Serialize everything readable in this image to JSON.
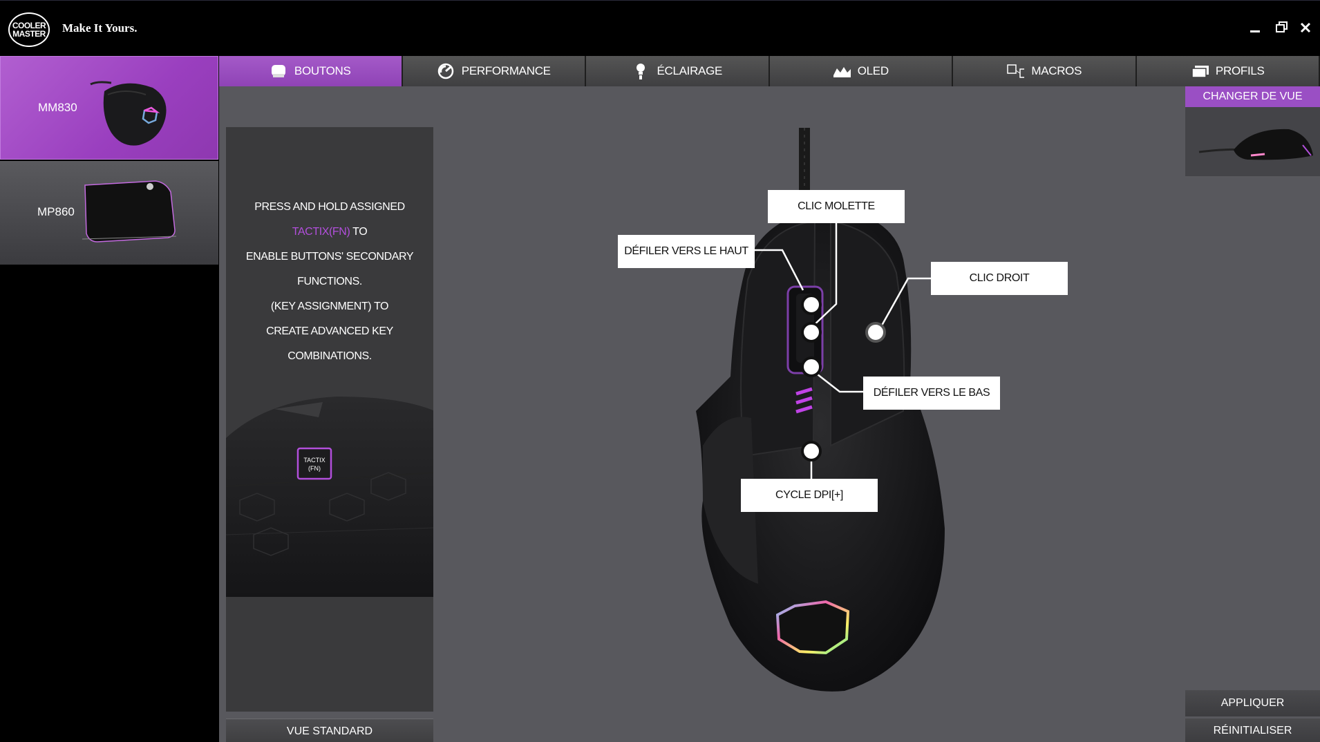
{
  "titlebar": {
    "logo_line1": "COOLER",
    "logo_line2": "MASTER",
    "tagline": "Make It Yours.",
    "minimize_icon": "minimize-icon",
    "restore_icon": "restore-icon",
    "close_icon": "close-icon"
  },
  "sidebar": {
    "devices": [
      {
        "label": "MM830",
        "icon": "mouse-icon",
        "selected": true
      },
      {
        "label": "MP860",
        "icon": "mousepad-icon",
        "selected": false
      }
    ]
  },
  "tabs": [
    {
      "label": "BOUTONS",
      "icon": "mouse-icon",
      "active": true
    },
    {
      "label": "PERFORMANCE",
      "icon": "gauge-icon",
      "active": false
    },
    {
      "label": "ÉCLAIRAGE",
      "icon": "bulb-icon",
      "active": false
    },
    {
      "label": "OLED",
      "icon": "oled-display-icon",
      "active": false
    },
    {
      "label": "MACROS",
      "icon": "macro-keys-icon",
      "active": false
    },
    {
      "label": "PROFILS",
      "icon": "profiles-icon",
      "active": false
    }
  ],
  "info": {
    "line1_pre": "PRESS AND HOLD ASSIGNED ",
    "line1_hl": "TACTIX(FN)",
    "line1_post": " TO",
    "line2": "ENABLE BUTTONS' SECONDARY FUNCTIONS.",
    "line3": "(KEY ASSIGNMENT) TO",
    "line4": "CREATE ADVANCED KEY COMBINATIONS.",
    "tactix_key_line1": "TACTIX",
    "tactix_key_line2": "(FN)",
    "standard_view_button": "VUE STANDARD"
  },
  "callouts": {
    "wheel_click": "CLIC MOLETTE",
    "scroll_up": "DÉFILER VERS LE HAUT",
    "right_click": "CLIC DROIT",
    "scroll_down": "DÉFILER VERS LE BAS",
    "dpi_cycle": "CYCLE DPI[+]"
  },
  "right_panel": {
    "change_view_button": "CHANGER DE VUE",
    "apply_button": "APPLIQUER",
    "reset_button": "RÉINITIALISER"
  },
  "colors": {
    "accent_purple": "#9a4fc4",
    "highlight_text": "#b24fdc",
    "main_bg": "#58585d"
  }
}
